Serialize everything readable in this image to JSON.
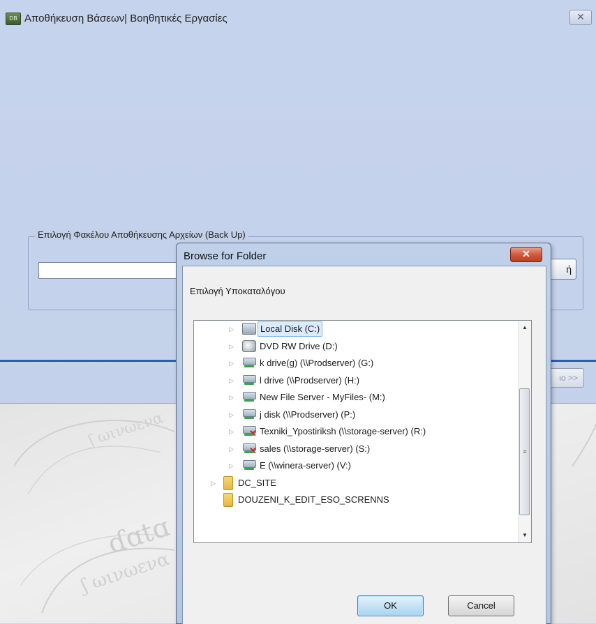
{
  "main_window": {
    "title": "Αποθήκευση Βάσεων| Βοηθητικές Εργασίες",
    "icon": "app-logo-icon",
    "close_glyph": "✕",
    "group_label": "Επιλογή Φακέλου Αποθήκευσης Αρχείων (Back Up)",
    "path_value": "",
    "select_button_partial": "ή",
    "next_button_partial": "ιο >>"
  },
  "dialog": {
    "title": "Browse for Folder",
    "close_glyph": "✕",
    "instruction": "Επιλογή Υποκαταλόγου",
    "items": [
      {
        "label": "Local Disk (C:)",
        "icon": "local-disk-icon",
        "selected": true
      },
      {
        "label": "DVD RW Drive (D:)",
        "icon": "dvd-drive-icon"
      },
      {
        "label": "k drive(g) (\\\\Prodserver) (G:)",
        "icon": "network-drive-icon"
      },
      {
        "label": "l drive (\\\\Prodserver) (H:)",
        "icon": "network-drive-icon"
      },
      {
        "label": "New File Server - MyFiles- (M:)",
        "icon": "network-drive-icon"
      },
      {
        "label": "j disk (\\\\Prodserver) (P:)",
        "icon": "network-drive-icon"
      },
      {
        "label": "Texniki_Ypostiriksh (\\\\storage-server) (R:)",
        "icon": "disconnected-network-drive-icon"
      },
      {
        "label": "sales (\\\\storage-server) (S:)",
        "icon": "disconnected-network-drive-icon"
      },
      {
        "label": "E (\\\\winera-server) (V:)",
        "icon": "network-drive-icon"
      },
      {
        "label": "DC_SITE",
        "icon": "folder-icon"
      },
      {
        "label": "DOUZENI_K_EDIT_ESO_SCRENNS",
        "icon": "folder-icon"
      }
    ],
    "ok_label": "OK",
    "cancel_label": "Cancel"
  },
  "colors": {
    "window_bg": "#c3d0e9",
    "separator": "#2d5db3",
    "close_button_red": "#c03d22",
    "selection_bg": "#dcebfc"
  }
}
